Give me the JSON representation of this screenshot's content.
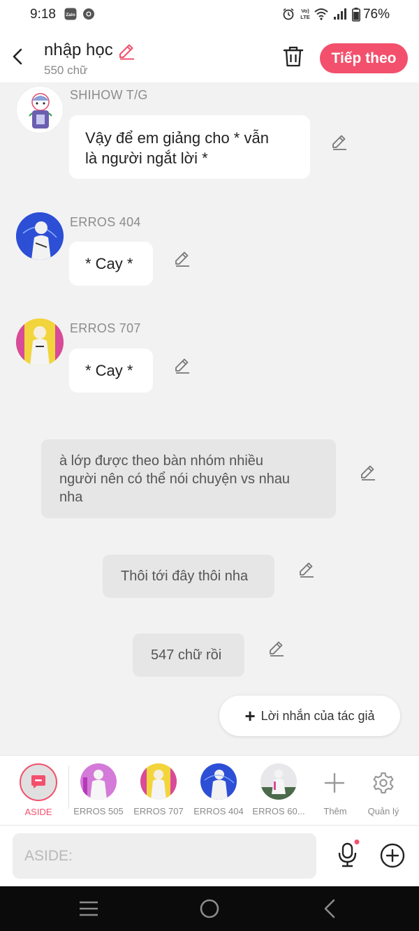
{
  "status_bar": {
    "time": "9:18",
    "battery": "76%"
  },
  "header": {
    "title": "nhập học",
    "word_count": "550 chữ",
    "next_label": "Tiếp theo"
  },
  "messages": [
    {
      "sender": "SHIHOW T/G",
      "text_line1": "Vậy để em giảng cho * vẫn",
      "text_line2": "là người ngắt lời *"
    },
    {
      "sender": "ERROS 404",
      "text": "* Cay *"
    },
    {
      "sender": "ERROS 707",
      "text": "* Cay *"
    }
  ],
  "narration": [
    {
      "line1": "à lớp được theo bàn nhóm nhiều",
      "line2": "người nên có thể nói chuyện vs nhau",
      "line3": "nha"
    },
    {
      "text": "Thôi tới đây thôi nha"
    },
    {
      "text": "547 chữ rồi"
    }
  ],
  "author_note_label": "Lời nhắn của tác giả",
  "characters": [
    {
      "label": "ASIDE"
    },
    {
      "label": "ERROS 505"
    },
    {
      "label": "ERROS 707"
    },
    {
      "label": "ERROS 404"
    },
    {
      "label": "ERROS 60..."
    },
    {
      "label": "Thêm"
    },
    {
      "label": "Quản lý"
    }
  ],
  "input": {
    "placeholder": "ASIDE:"
  },
  "colors": {
    "accent": "#f2506c",
    "bubble": "#ffffff",
    "narration_bg": "#e6e6e6",
    "background": "#f2f2f2",
    "nav_bar": "#0b0b0b"
  }
}
